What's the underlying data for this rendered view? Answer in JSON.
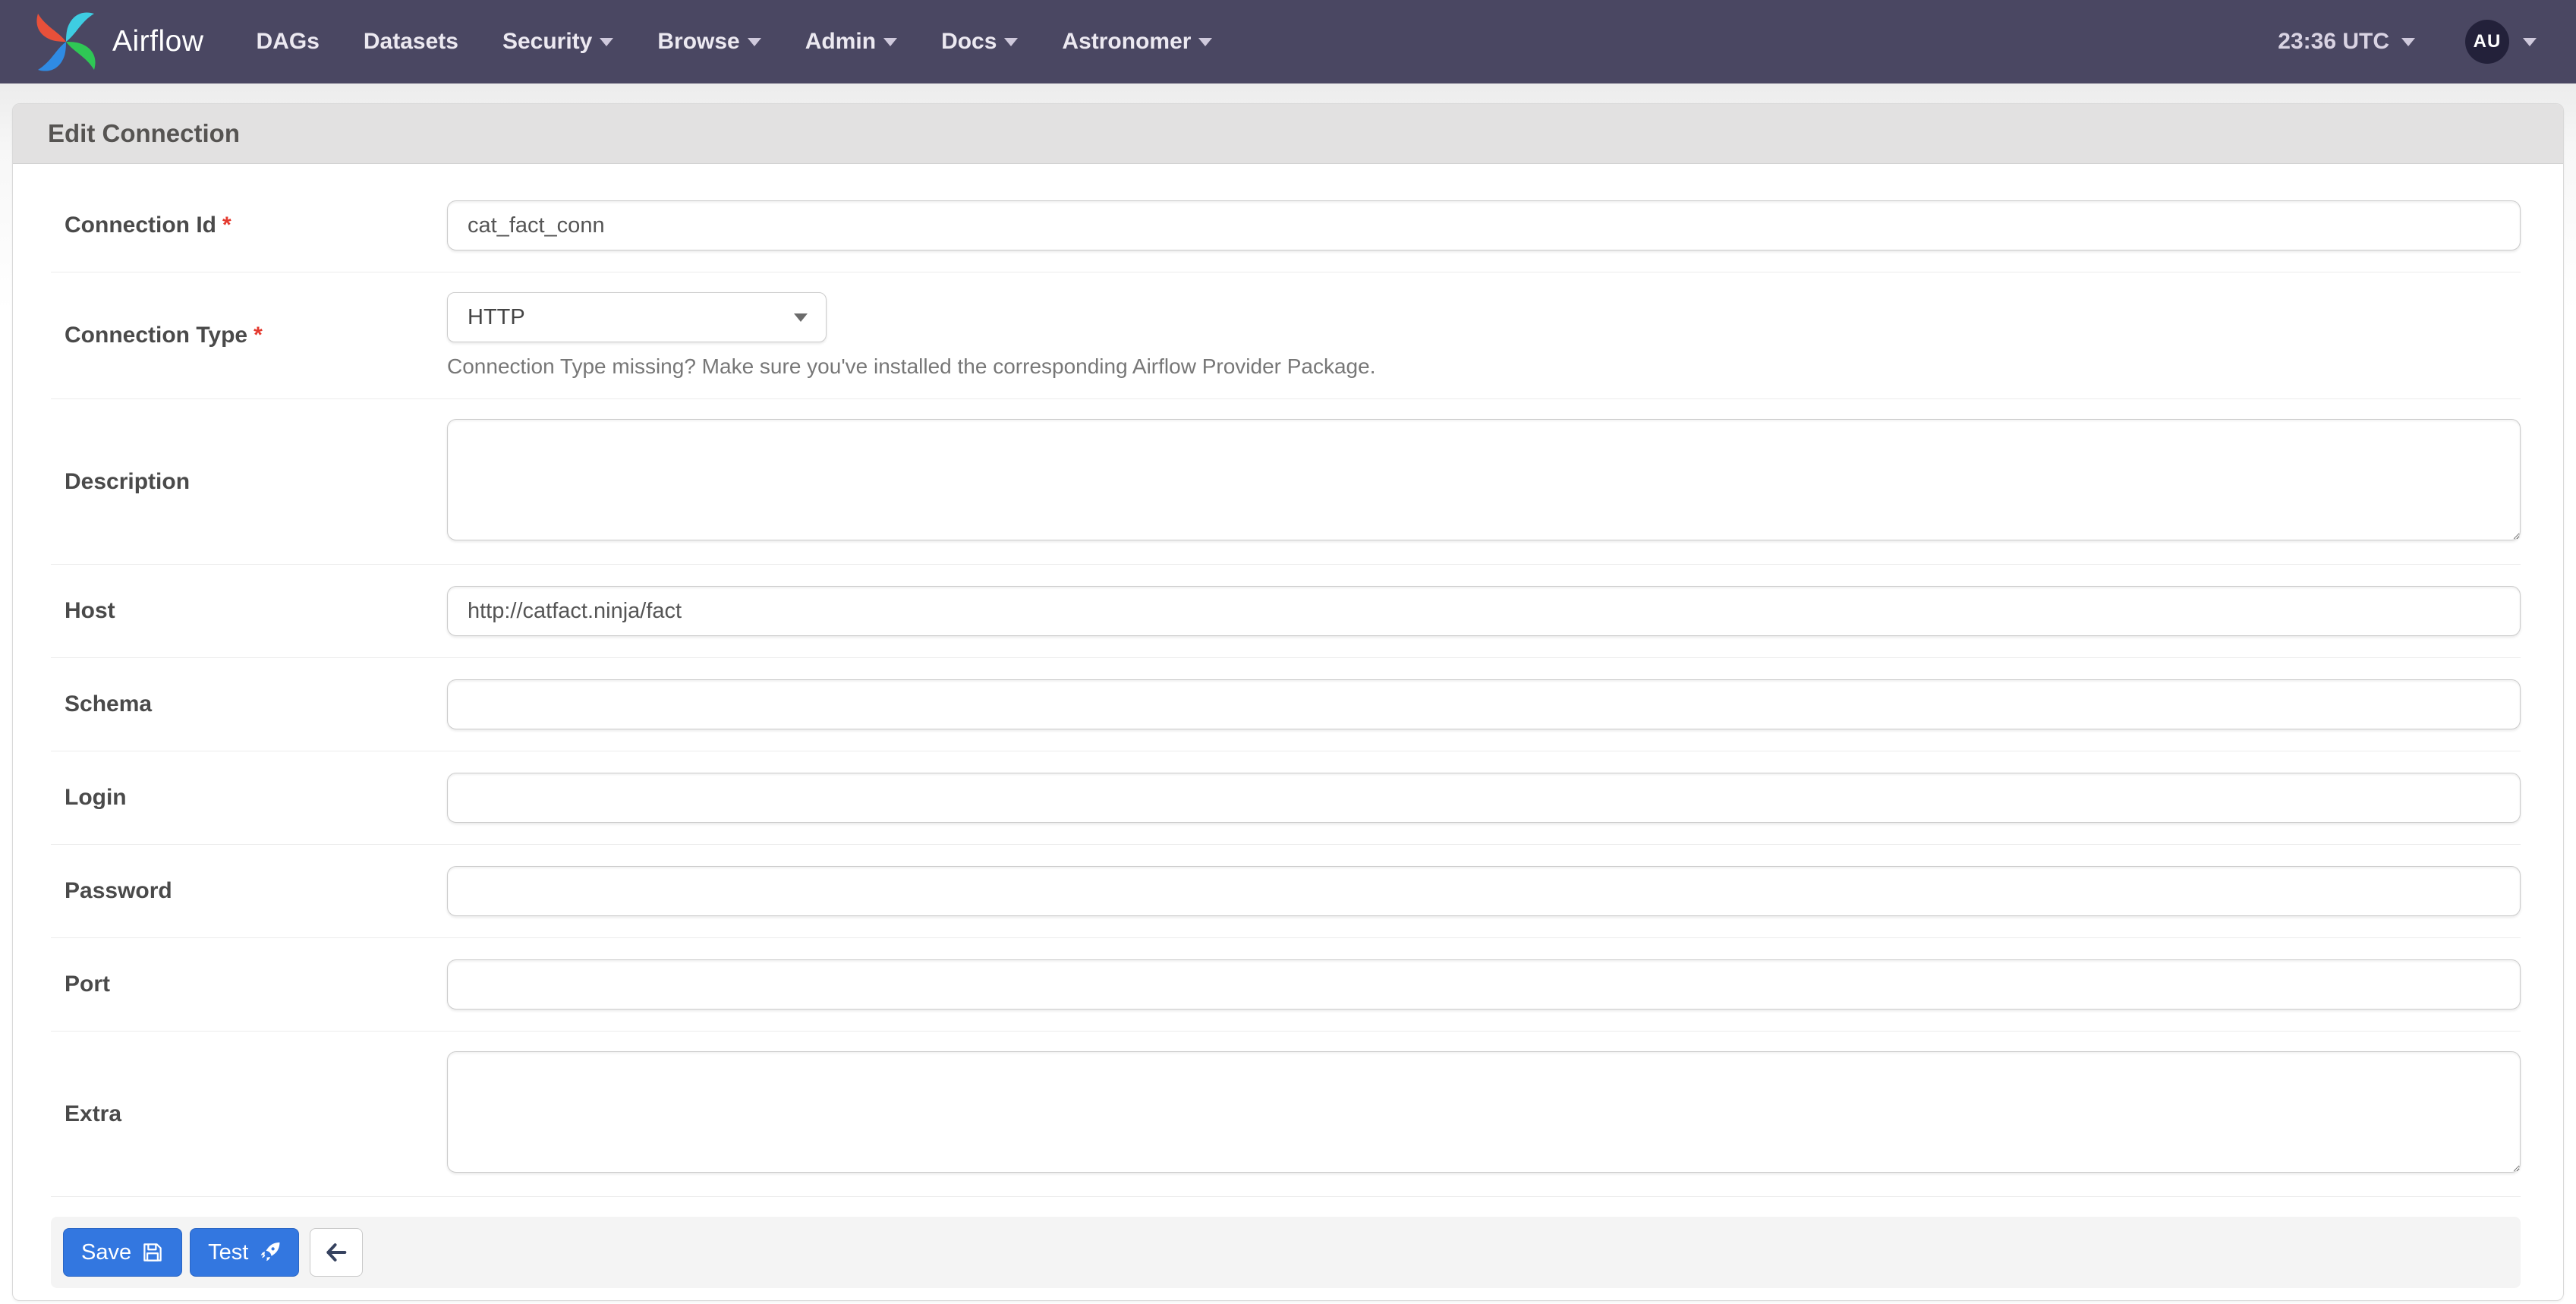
{
  "navbar": {
    "brand": "Airflow",
    "items": [
      {
        "label": "DAGs",
        "caret": false
      },
      {
        "label": "Datasets",
        "caret": false
      },
      {
        "label": "Security",
        "caret": true
      },
      {
        "label": "Browse",
        "caret": true
      },
      {
        "label": "Admin",
        "caret": true
      },
      {
        "label": "Docs",
        "caret": true
      },
      {
        "label": "Astronomer",
        "caret": true
      }
    ],
    "clock": "23:36 UTC",
    "avatar_initials": "AU"
  },
  "page": {
    "title": "Edit Connection"
  },
  "form": {
    "required_marker": "*",
    "fields": [
      {
        "label": "Connection Id",
        "required": true,
        "type": "input",
        "value": "cat_fact_conn"
      },
      {
        "label": "Connection Type",
        "required": true,
        "type": "select",
        "value": "HTTP",
        "helper": "Connection Type missing? Make sure you've installed the corresponding Airflow Provider Package."
      },
      {
        "label": "Description",
        "required": false,
        "type": "textarea",
        "value": ""
      },
      {
        "label": "Host",
        "required": false,
        "type": "input",
        "value": "http://catfact.ninja/fact"
      },
      {
        "label": "Schema",
        "required": false,
        "type": "input",
        "value": ""
      },
      {
        "label": "Login",
        "required": false,
        "type": "input",
        "value": ""
      },
      {
        "label": "Password",
        "required": false,
        "type": "input",
        "value": ""
      },
      {
        "label": "Port",
        "required": false,
        "type": "input",
        "value": ""
      },
      {
        "label": "Extra",
        "required": false,
        "type": "textarea",
        "value": ""
      }
    ],
    "buttons": {
      "save": "Save",
      "test": "Test"
    }
  },
  "colors": {
    "navbar_bg": "#4a4762",
    "accent_blue": "#3377e0",
    "required_red": "#e4392e",
    "panel_header_bg": "#e2e1e1",
    "footer_bg": "#f4f4f4",
    "avatar_bg": "#23213a"
  }
}
